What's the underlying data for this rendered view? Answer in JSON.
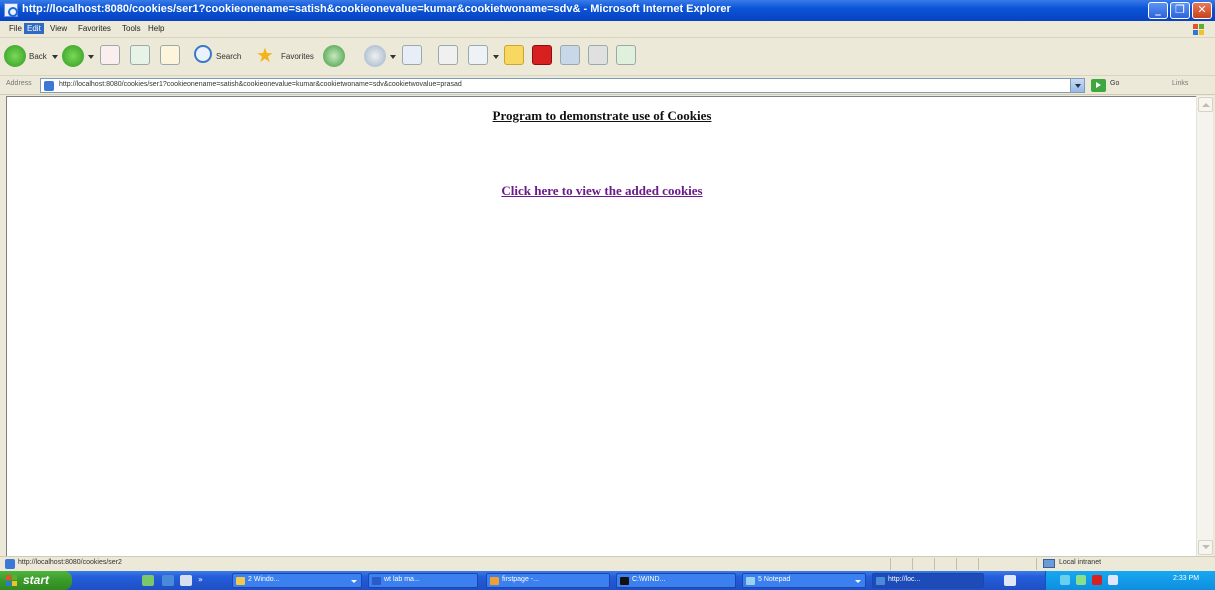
{
  "window": {
    "title": "http://localhost:8080/cookies/ser1?cookieonename=satish&cookieonevalue=kumar&cookietwoname=sdv& - Microsoft Internet Explorer",
    "minimize": "_",
    "maximize": "❐",
    "close": "✕"
  },
  "menu": {
    "items": [
      "File",
      "Edit",
      "View",
      "Favorites",
      "Tools",
      "Help"
    ]
  },
  "toolbar": {
    "back": "Back",
    "search": "Search",
    "favorites": "Favorites"
  },
  "address": {
    "label": "Address",
    "url": "http://localhost:8080/cookies/ser1?cookieonename=satish&cookieonevalue=kumar&cookietwoname=sdv&cookietwovalue=prasad",
    "go": "Go",
    "links": "Links"
  },
  "content": {
    "heading": "Program to demonstrate use of Cookies",
    "link_text": "Click here to view the added cookies"
  },
  "status": {
    "text": "http://localhost:8080/cookies/ser2",
    "zone": "Local intranet"
  },
  "taskbar": {
    "start": "start",
    "tasks": [
      "2 Windo...",
      "wt lab ma...",
      "firstpage -...",
      "C:\\WIND...",
      "5 Notepad",
      "http://loc..."
    ],
    "clock": "2:33 PM"
  },
  "colors": {
    "link_visited": "#6a1a8a",
    "titlebar": "#0a54d8",
    "taskbar": "#245edb",
    "start": "#3a9a2a"
  }
}
